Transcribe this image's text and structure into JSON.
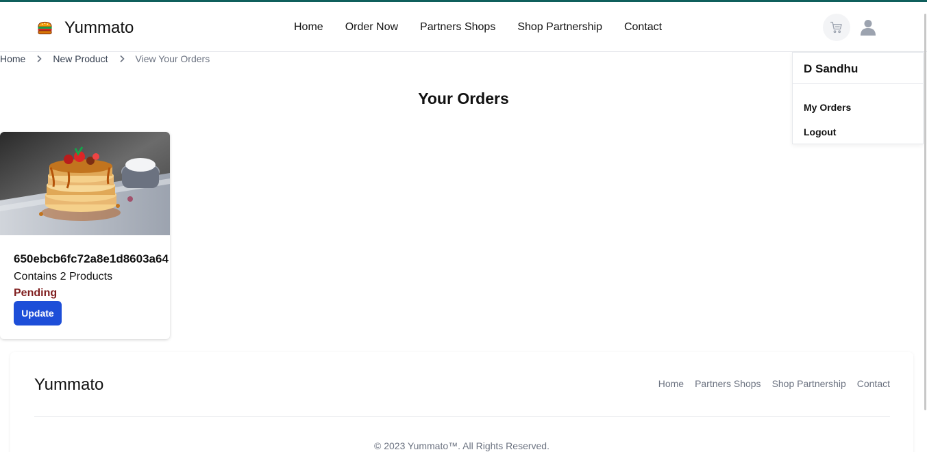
{
  "brand": {
    "name": "Yummato"
  },
  "nav": {
    "links": [
      "Home",
      "Order Now",
      "Partners Shops",
      "Shop Partnership",
      "Contact"
    ]
  },
  "header_icons": {
    "cart": "cart-icon",
    "user": "user-icon"
  },
  "breadcrumb": {
    "items": [
      "Home",
      "New Product",
      "View Your Orders"
    ],
    "separator_icon": "chevron-right-icon"
  },
  "page": {
    "title": "Your Orders"
  },
  "orders": [
    {
      "id": "650ebcb6fc72a8e1d8603a64",
      "summary": "Contains 2 Products",
      "status": "Pending",
      "action_label": "Update",
      "image": "pancake-stack-photo"
    }
  ],
  "user_menu": {
    "name": "D Sandhu",
    "items": [
      "My Orders",
      "Logout"
    ]
  },
  "footer": {
    "brand": "Yummato",
    "links": [
      "Home",
      "Partners Shops",
      "Shop Partnership",
      "Contact"
    ],
    "copyright": "© 2023 Yummato™. All Rights Reserved."
  },
  "colors": {
    "accent_line": "#0f5f5c",
    "primary_button": "#1d4ed8",
    "status_pending": "#7f1d1d",
    "muted_text": "#6b7280"
  }
}
